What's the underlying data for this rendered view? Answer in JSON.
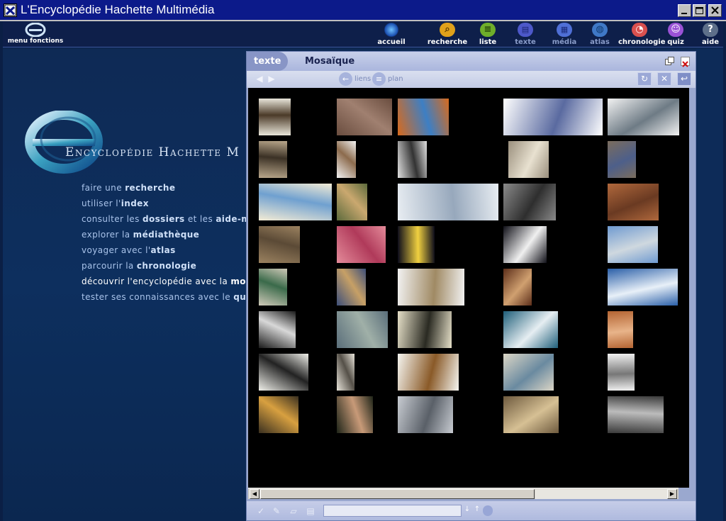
{
  "window": {
    "title": "L'Encyclopédie Hachette Multimédia"
  },
  "toolbar": {
    "menu_label": "menu fonctions",
    "items": [
      {
        "label": "accueil",
        "icon": "home-sparkle-icon",
        "color": "#2d7bd6",
        "enabled": true
      },
      {
        "label": "recherche",
        "icon": "search-icon",
        "color": "#e0a11a",
        "enabled": true
      },
      {
        "label": "liste",
        "icon": "list-icon",
        "color": "#6fae2a",
        "enabled": true
      },
      {
        "label": "texte",
        "icon": "text-icon",
        "color": "#4d58c9",
        "enabled": false
      },
      {
        "label": "média",
        "icon": "film-icon",
        "color": "#4f6fd6",
        "enabled": false
      },
      {
        "label": "atlas",
        "icon": "globe-icon",
        "color": "#3f78c6",
        "enabled": false
      },
      {
        "label": "chronologie",
        "icon": "clock-icon",
        "color": "#d8504f",
        "enabled": true
      },
      {
        "label": "quiz",
        "icon": "smiley-icon",
        "color": "#9a52d6",
        "enabled": true
      },
      {
        "label": "aide",
        "icon": "help-icon",
        "color": "#5d6f8a",
        "enabled": true
      }
    ]
  },
  "logo": {
    "text": "Encyclopédie Hachette M"
  },
  "menu": [
    {
      "plain": "faire une ",
      "bold": "recherche",
      "tail": ""
    },
    {
      "plain": "utiliser l'",
      "bold": "index",
      "tail": ""
    },
    {
      "plain": "consulter les ",
      "bold": "dossiers",
      "tail": " et les ",
      "bold2": "aide-mém"
    },
    {
      "plain": "explorer la ",
      "bold": "médiathèque",
      "tail": ""
    },
    {
      "plain": "voyager avec l'",
      "bold": "atlas",
      "tail": ""
    },
    {
      "plain": "parcourir la ",
      "bold": "chronologie",
      "tail": ""
    },
    {
      "plain": "découvrir l'encyclopédie avec la ",
      "bold": "mosaïq",
      "tail": "",
      "active": true
    },
    {
      "plain": "tester ses connaissances avec le ",
      "bold": "quiz",
      "tail": ""
    }
  ],
  "mosaic_window": {
    "tab_label": "texte",
    "title": "Mosaïque",
    "liens_label": "liens",
    "plan_label": "plan",
    "thumbnails": [
      {
        "subject": "moose",
        "colors": [
          "#e9e6da",
          "#4b3a28"
        ]
      },
      {
        "subject": "painting-figures",
        "colors": [
          "#6a4d3f",
          "#a08070"
        ]
      },
      {
        "subject": "map-roman-empire",
        "colors": [
          "#d86a1c",
          "#3d7fc4"
        ]
      },
      {
        "subject": "diagram",
        "colors": [
          "#ffffff",
          "#5a6aa0"
        ]
      },
      {
        "subject": "shark",
        "colors": [
          "#f2f2f2",
          "#6e7b85"
        ]
      },
      {
        "subject": "bust-statue",
        "colors": [
          "#b9a78b",
          "#3b3125"
        ]
      },
      {
        "subject": "thermometer",
        "colors": [
          "#f2f2f2",
          "#8c6b4d"
        ]
      },
      {
        "subject": "figure-drawing",
        "colors": [
          "#e0e0e0",
          "#333333"
        ]
      },
      {
        "subject": "relief-sculpture",
        "colors": [
          "#9a8f7d",
          "#e8e1d0"
        ]
      },
      {
        "subject": "mineral",
        "colors": [
          "#7b6d5d",
          "#4d5f8a"
        ]
      },
      {
        "subject": "family-tree",
        "colors": [
          "#f4ecd5",
          "#6fa0d0"
        ]
      },
      {
        "subject": "old-man-portrait",
        "colors": [
          "#5c6a3c",
          "#caa86f"
        ]
      },
      {
        "subject": "vintage-car",
        "colors": [
          "#e8edf2",
          "#97a8bc"
        ]
      },
      {
        "subject": "theatre-stage",
        "colors": [
          "#8a8a8a",
          "#2e2e2e"
        ]
      },
      {
        "subject": "byzantine-mosaic",
        "colors": [
          "#b0683c",
          "#6a3a22"
        ]
      },
      {
        "subject": "clay-tablet",
        "colors": [
          "#9b8260",
          "#5b4a36"
        ]
      },
      {
        "subject": "tissue-micro",
        "colors": [
          "#e48b9a",
          "#b03a5a"
        ]
      },
      {
        "subject": "galaxy",
        "colors": [
          "#0a0a1a",
          "#f0d040"
        ]
      },
      {
        "subject": "astronaut",
        "colors": [
          "#101018",
          "#f0f0f0"
        ]
      },
      {
        "subject": "city-river",
        "colors": [
          "#6f9ad0",
          "#cfd8df"
        ]
      },
      {
        "subject": "art-deco-woman",
        "colors": [
          "#cfc9b8",
          "#3a6a4a"
        ]
      },
      {
        "subject": "river-town",
        "colors": [
          "#3d4f7a",
          "#c7a066"
        ]
      },
      {
        "subject": "aztec-temple-model",
        "colors": [
          "#f2f2f2",
          "#a08a64"
        ]
      },
      {
        "subject": "baroque-portrait",
        "colors": [
          "#5c2e1a",
          "#d0a070"
        ]
      },
      {
        "subject": "waterfalls",
        "colors": [
          "#2a5fa8",
          "#e8f0f8"
        ]
      },
      {
        "subject": "singer-bw",
        "colors": [
          "#1a1a1a",
          "#d8d8d8"
        ]
      },
      {
        "subject": "aerial-harbour",
        "colors": [
          "#5a6e7a",
          "#a0b0a8"
        ]
      },
      {
        "subject": "chimpanzees",
        "colors": [
          "#e6e0c8",
          "#2a2a22"
        ]
      },
      {
        "subject": "island-waves",
        "colors": [
          "#1f5f7a",
          "#e6eef2"
        ]
      },
      {
        "subject": "woman-in-hat",
        "colors": [
          "#b46432",
          "#e8b48a"
        ]
      },
      {
        "subject": "newspaper-loeuvre",
        "colors": [
          "#f0f0ea",
          "#222222"
        ]
      },
      {
        "subject": "manuscript",
        "colors": [
          "#e8e4da",
          "#555048"
        ]
      },
      {
        "subject": "german-shepherd",
        "colors": [
          "#f5f5f0",
          "#8a5a28"
        ]
      },
      {
        "subject": "white-city",
        "colors": [
          "#dcd6c6",
          "#6a8aa0"
        ]
      },
      {
        "subject": "lace-pattern",
        "colors": [
          "#f2f2f2",
          "#777777"
        ]
      },
      {
        "subject": "leopard",
        "colors": [
          "#3a3020",
          "#d8a040"
        ]
      },
      {
        "subject": "renaissance-couple",
        "colors": [
          "#1e2418",
          "#c89a78"
        ]
      },
      {
        "subject": "street-building",
        "colors": [
          "#c8ccd2",
          "#5a6068"
        ]
      },
      {
        "subject": "assembly-painting",
        "colors": [
          "#6e5a3e",
          "#d6c094"
        ]
      },
      {
        "subject": "crowd-hall",
        "colors": [
          "#3a3a3a",
          "#bcbcbc"
        ]
      }
    ]
  }
}
